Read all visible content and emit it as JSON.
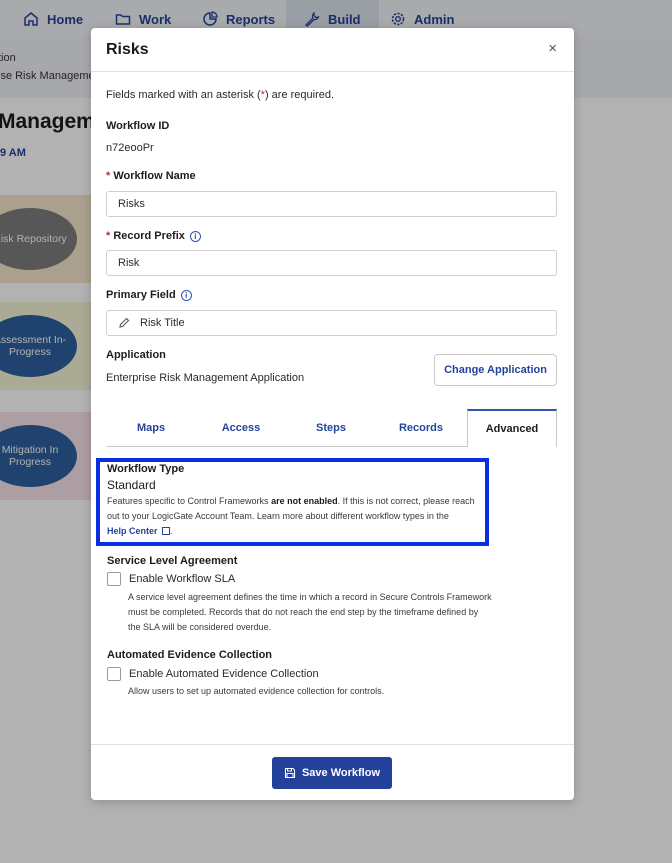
{
  "nav": {
    "home": "Home",
    "work": "Work",
    "reports": "Reports",
    "build": "Build",
    "admin": "Admin"
  },
  "background": {
    "breadcrumb_1": "tion",
    "breadcrumb_2": "ise Risk Manageme",
    "title": "Managemer",
    "time": "9 AM",
    "steps": [
      {
        "label": "Risk Repository",
        "color": "#7d7d7d",
        "lane": "#f5e6cc"
      },
      {
        "label": "Assessment In-Progress",
        "color": "#2f5f9e",
        "lane": "#f4f4d6"
      },
      {
        "label": "Mitigation In Progress",
        "color": "#2f5f9e",
        "lane": "#f8e3ea"
      }
    ]
  },
  "modal": {
    "title": "Risks",
    "close": "×",
    "required_note_prefix": "Fields marked with an asterisk (",
    "required_note_asterisk": "*",
    "required_note_suffix": ") are required.",
    "workflow_id_label": "Workflow ID",
    "workflow_id": "n72eooPr",
    "workflow_name_label": "Workflow Name",
    "workflow_name": "Risks",
    "record_prefix_label": "Record Prefix",
    "record_prefix": "Risk",
    "primary_field_label": "Primary Field",
    "primary_field": "Risk Title",
    "application_label": "Application",
    "application": "Enterprise Risk Management Application",
    "change_application": "Change Application",
    "tabs": [
      "Maps",
      "Access",
      "Steps",
      "Records",
      "Advanced"
    ],
    "active_tab": "Advanced",
    "workflow_type_label": "Workflow Type",
    "workflow_type": "Standard",
    "wt_desc_1": "Features specific to Control Frameworks ",
    "wt_desc_bold": "are not enabled",
    "wt_desc_2": ". If this is not correct, please reach",
    "wt_desc_3": "out to your LogicGate Account Team.  Learn more about different workflow types in the",
    "help_center": "Help Center",
    "sla_label": "Service Level Agreement",
    "sla_checkbox": "Enable Workflow SLA",
    "sla_desc_1": "A service level agreement defines the time in which a record in Secure Controls Framework",
    "sla_desc_2": "must be completed. Records that do not reach the end step by the timeframe defined by",
    "sla_desc_3": "the SLA will be considered overdue.",
    "aec_label": "Automated Evidence Collection",
    "aec_checkbox": "Enable Automated Evidence Collection",
    "aec_desc": "Allow users to set up automated evidence collection for controls.",
    "save": "Save Workflow"
  },
  "icons": [
    "home-icon",
    "work-folder-icon",
    "reports-chart-icon",
    "build-wrench-icon",
    "admin-gear-icon",
    "info-icon",
    "pencil-icon",
    "external-link-icon",
    "save-disk-icon",
    "close-icon"
  ]
}
